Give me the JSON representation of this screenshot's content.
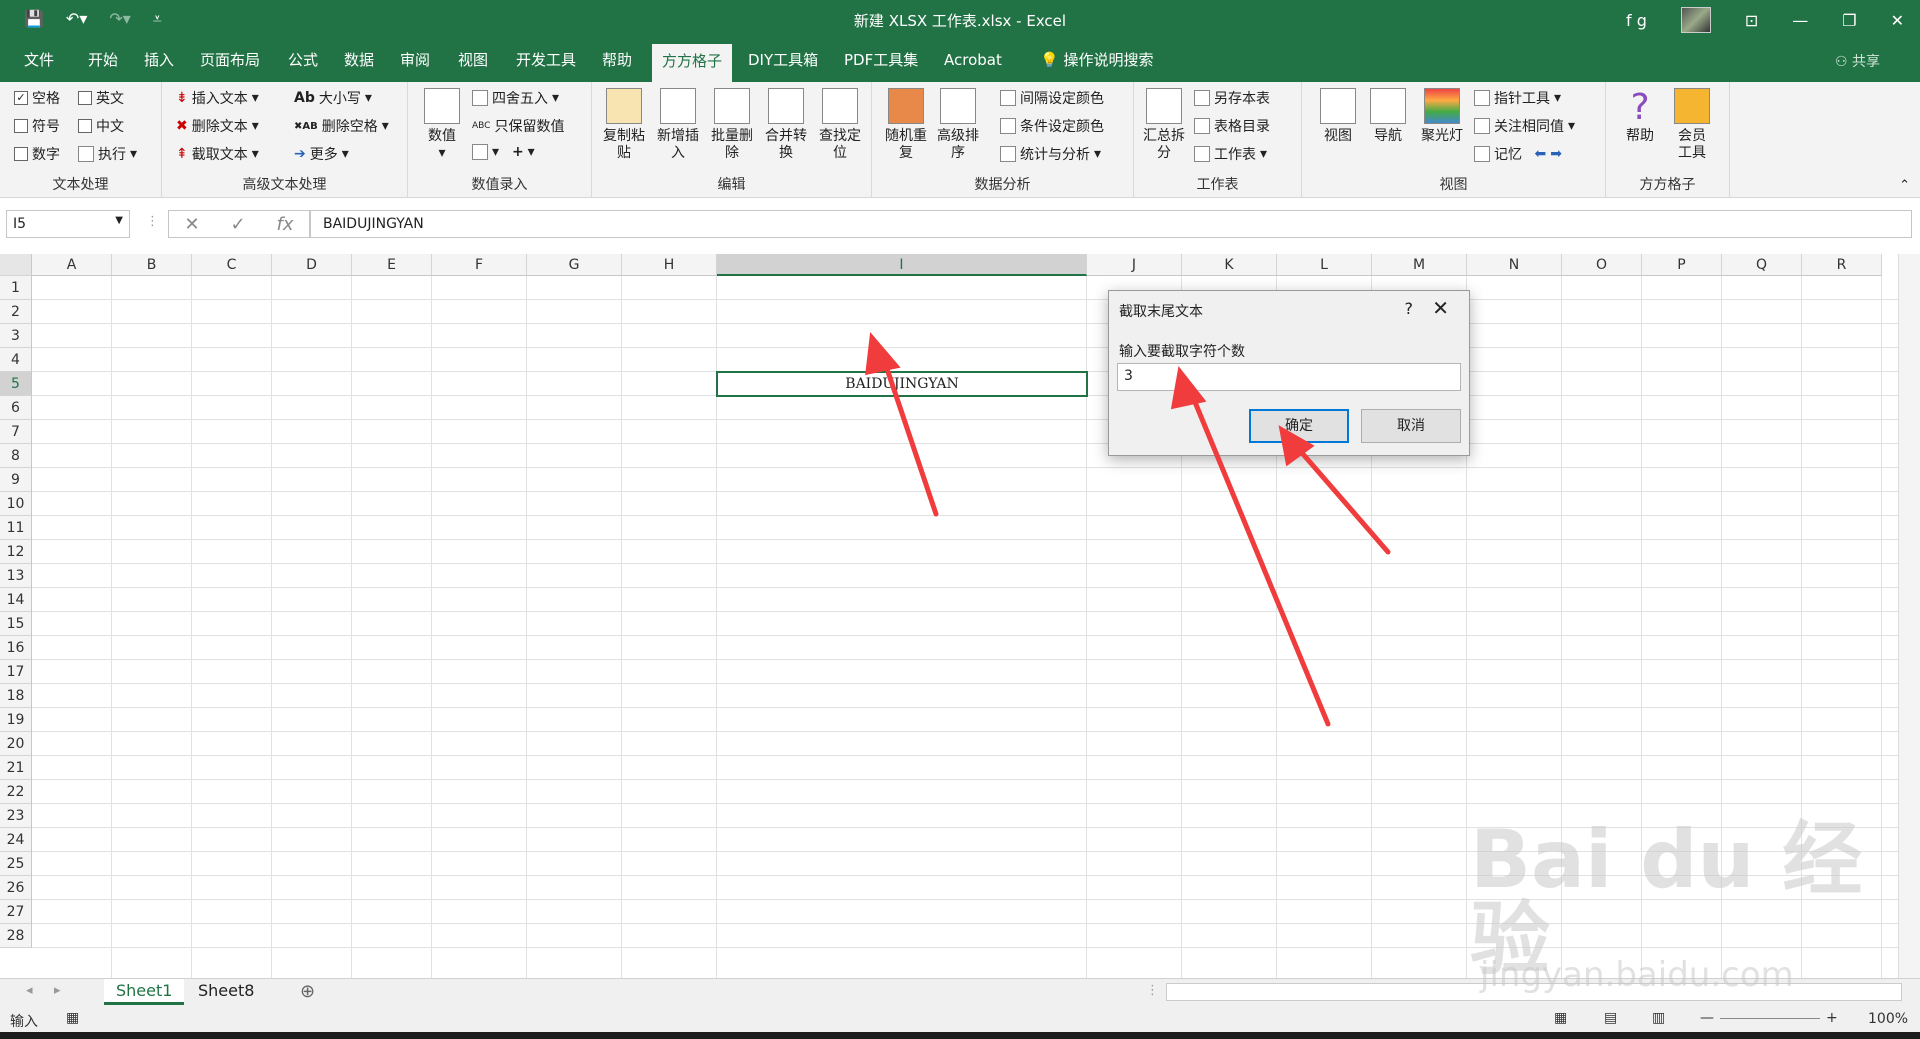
{
  "window": {
    "title": "新建 XLSX 工作表.xlsx  -  Excel",
    "user": "f g",
    "share": "共享"
  },
  "tabs": [
    "文件",
    "开始",
    "插入",
    "页面布局",
    "公式",
    "数据",
    "审阅",
    "视图",
    "开发工具",
    "帮助",
    "方方格子",
    "DIY工具箱",
    "PDF工具集",
    "Acrobat",
    "操作说明搜索"
  ],
  "active_tab": "方方格子",
  "ribbon": {
    "text_group": {
      "label": "文本处理",
      "checks": [
        {
          "label": "空格",
          "checked": true
        },
        {
          "label": "英文",
          "checked": false
        },
        {
          "label": "符号",
          "checked": false
        },
        {
          "label": "中文",
          "checked": false
        },
        {
          "label": "数字",
          "checked": false
        }
      ],
      "exec": "执行"
    },
    "adv_text": {
      "label": "高级文本处理",
      "items": [
        "插入文本",
        "删除文本",
        "截取文本",
        "大小写",
        "删除空格",
        "更多"
      ]
    },
    "num_input": {
      "label": "数值录入",
      "items": [
        "数值",
        "四舍五入",
        "只保留数值"
      ]
    },
    "edit": {
      "label": "编辑",
      "buttons": [
        "复制粘贴",
        "新增插入",
        "批量删除",
        "合并转换",
        "查找定位"
      ]
    },
    "analysis": {
      "label": "数据分析",
      "buttons": [
        "随机重复",
        "高级排序"
      ],
      "items": [
        "间隔设定颜色",
        "条件设定颜色",
        "统计与分析"
      ]
    },
    "worksheet": {
      "label": "工作表",
      "buttons": [
        "汇总拆分"
      ],
      "items": [
        "另存本表",
        "表格目录",
        "工作表"
      ]
    },
    "view": {
      "label": "视图",
      "buttons": [
        "视图",
        "导航",
        "聚光灯"
      ],
      "items": [
        "指针工具",
        "关注相同值",
        "记忆"
      ]
    },
    "ffgz": {
      "label": "方方格子",
      "buttons": [
        "帮助",
        "会员工具"
      ]
    }
  },
  "formula_bar": {
    "name_box": "I5",
    "formula": "BAIDUJINGYAN"
  },
  "columns": [
    "A",
    "B",
    "C",
    "D",
    "E",
    "F",
    "G",
    "H",
    "I",
    "J",
    "K",
    "L",
    "M",
    "N",
    "O",
    "P",
    "Q",
    "R"
  ],
  "rows": [
    "1",
    "2",
    "3",
    "4",
    "5",
    "6",
    "7",
    "8",
    "9",
    "10",
    "11",
    "12",
    "13",
    "14",
    "15",
    "16",
    "17",
    "18",
    "19",
    "20",
    "21",
    "22",
    "23",
    "24",
    "25",
    "26",
    "27",
    "28"
  ],
  "selected_cell": {
    "value": "BAIDUJINGYAN"
  },
  "sheets": [
    "Sheet1",
    "Sheet8"
  ],
  "active_sheet": "Sheet1",
  "status": {
    "mode": "输入",
    "zoom": "100%"
  },
  "dialog": {
    "title": "截取末尾文本",
    "help": "?",
    "prompt": "输入要截取字符个数",
    "value": "3",
    "ok": "确定",
    "cancel": "取消"
  },
  "watermark": {
    "brand": "Bai du 经验",
    "url": "jingyan.baidu.com"
  }
}
